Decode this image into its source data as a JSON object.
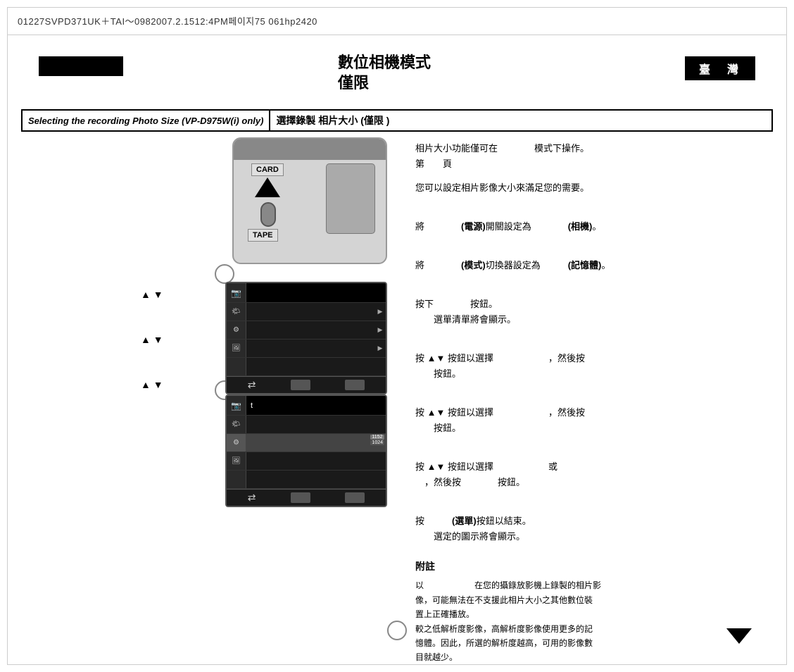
{
  "header": {
    "text": "01227SVPD371UK＋TAI～0982007.2.1512:4PM페이지75 061hp2420"
  },
  "taiwan_badge": {
    "label": "臺　灣"
  },
  "title": {
    "main": "數位相機模式",
    "sub": "僅限"
  },
  "section": {
    "left_label": "Selecting the recording Photo Size (VP-D975W(i) only)",
    "right_label": "選擇錄製 相片大小 (僅限                     )"
  },
  "camera": {
    "card_label": "CARD",
    "tape_label": "TAPE"
  },
  "instructions": [
    {
      "text": "相片大小功能僅可在　　　　模式下操作。",
      "line2": "第　　頁"
    },
    {
      "text": "您可以設定相片影像大小來滿足您的需要。"
    },
    {
      "text": "將　　　　(電源)開關設定為　　　　(相機)。"
    },
    {
      "text": "將　　　　(模式)切換器設定為　　　(記憶體)。"
    },
    {
      "text": "按下　　　　按鈕。",
      "line2": "選單清單將會顯示。"
    },
    {
      "text": "按 ▲▼ 按鈕以選擇　　　　　　，然後按",
      "line2": "　　按鈕。"
    },
    {
      "text": "按 ▲▼ 按鈕以選擇　　　　　　，然後按",
      "line2": "　　按鈕。"
    },
    {
      "text": "按 ▲▼ 按鈕以選擇　　　　　　或",
      "line2": "　，然後按　　　　按鈕。"
    },
    {
      "text": "按　　　(選單)按鈕以結束。",
      "line2": "選定的圖示將會顯示。"
    }
  ],
  "note": {
    "title": "附註",
    "lines": [
      "以　　　　　　在您的攝錄放影機上錄製的相片影",
      "像，可能無法在不支援此相片大小之其他數位裝",
      "置上正確播放。",
      "較之低解析度影像，高解析度影像使用更多的記",
      "憶體。因此，所選的解析度越高，可用的影像數",
      "目就越少。"
    ]
  },
  "nav_arrows": [
    {
      "symbols": "▲ ▼"
    },
    {
      "symbols": "▲ ▼"
    },
    {
      "symbols": "▲ ▼"
    }
  ],
  "menu_top": {
    "rows": [
      {
        "icon": "📷",
        "text": "",
        "has_arrow": false,
        "type": "header"
      },
      {
        "icon": "☁",
        "text": "",
        "has_arrow": true
      },
      {
        "icon": "⚙",
        "text": "",
        "has_arrow": true
      },
      {
        "icon": "🖼",
        "text": "",
        "has_arrow": true
      },
      {
        "icon": "",
        "text": "",
        "has_arrow": false
      }
    ]
  },
  "menu_bottom": {
    "rows": [
      {
        "icon": "📷",
        "text": "t",
        "has_arrow": false,
        "type": "header"
      },
      {
        "icon": "☁",
        "text": "",
        "has_arrow": false
      },
      {
        "icon": "⚙",
        "text": "",
        "has_arrow": false,
        "highlighted": true,
        "resolution1": "1152",
        "resolution2": "1024"
      },
      {
        "icon": "🖼",
        "text": "",
        "has_arrow": false
      },
      {
        "icon": "",
        "text": "",
        "has_arrow": false
      }
    ]
  },
  "colors": {
    "black": "#000000",
    "dark_gray": "#1a1a1a",
    "medium_gray": "#888888",
    "light_gray": "#d4d4d4",
    "white": "#ffffff"
  }
}
